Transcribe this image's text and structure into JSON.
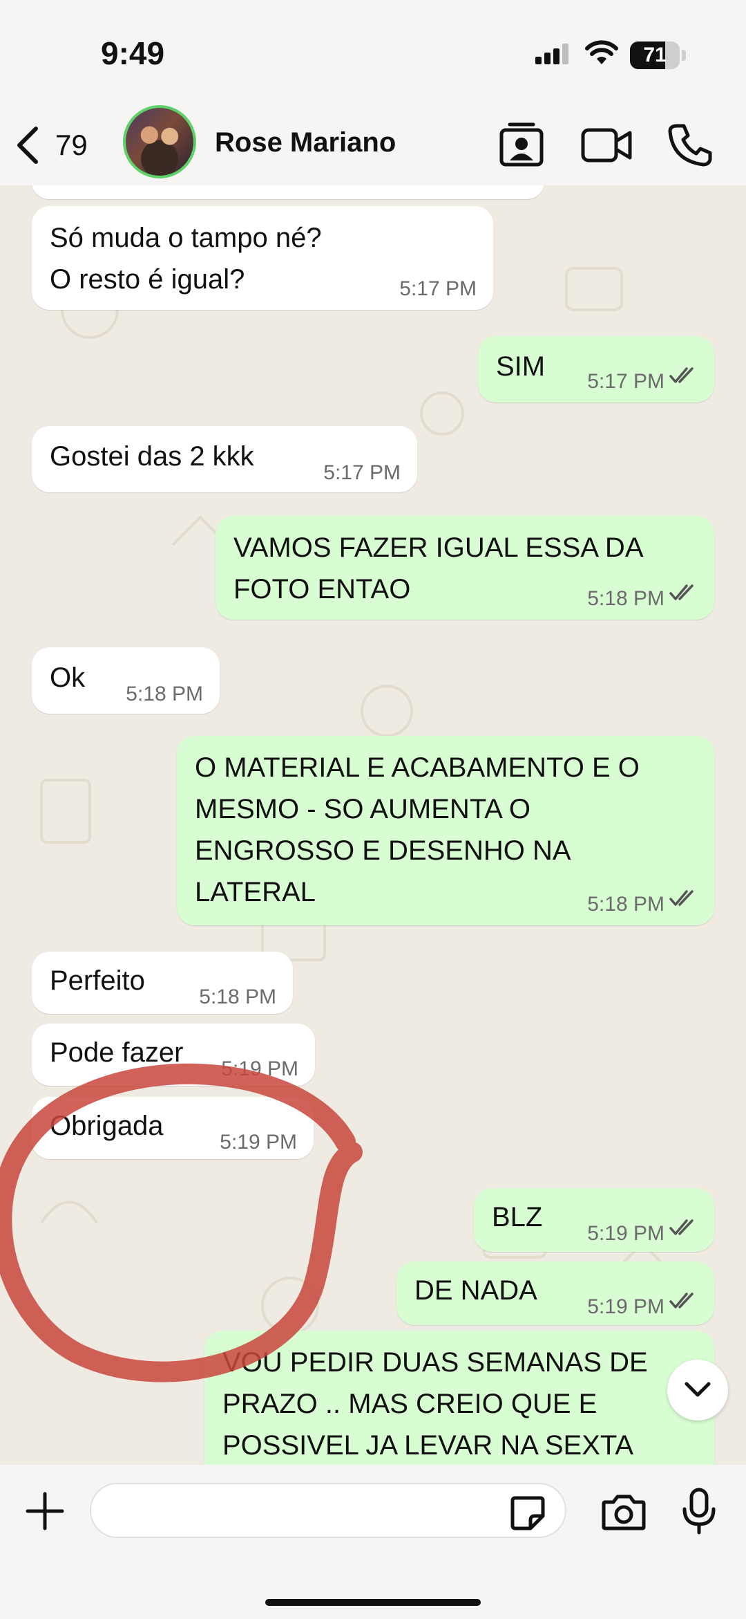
{
  "status_bar": {
    "time": "9:49",
    "battery_percent": "71",
    "battery_level": 0.71
  },
  "header": {
    "back_count": "79",
    "contact_name": "Rose Mariano"
  },
  "messages": [
    {
      "dir": "in",
      "text": "Só muda o tampo né?\nO resto é igual?",
      "time": "5:17 PM"
    },
    {
      "dir": "out",
      "text": "SIM",
      "time": "5:17 PM",
      "read": true
    },
    {
      "dir": "in",
      "text": "Gostei das 2 kkk",
      "time": "5:17 PM"
    },
    {
      "dir": "out",
      "text": "VAMOS FAZER IGUAL ESSA DA\nFOTO ENTAO",
      "time": "5:18 PM",
      "read": true
    },
    {
      "dir": "in",
      "text": "Ok",
      "time": "5:18 PM"
    },
    {
      "dir": "out",
      "text": "O MATERIAL E ACABAMENTO E O\nMESMO -   SO AUMENTA O\nENGROSSO E DESENHO NA\nLATERAL",
      "time": "5:18 PM",
      "read": true
    },
    {
      "dir": "in",
      "text": "Perfeito",
      "time": "5:18 PM"
    },
    {
      "dir": "in",
      "text": "Pode fazer",
      "time": "5:19 PM"
    },
    {
      "dir": "in",
      "text": "Obrigada",
      "time": "5:19 PM"
    },
    {
      "dir": "out",
      "text": "BLZ",
      "time": "5:19 PM",
      "read": true
    },
    {
      "dir": "out",
      "text": "DE NADA",
      "time": "5:19 PM",
      "read": true
    },
    {
      "dir": "out",
      "text": "VOU PEDIR DUAS SEMANAS DE\nPRAZO ..  MAS CREIO QUE E\nPOSSIVEL JA LEVAR NA SEXTA",
      "time": "",
      "read": true
    }
  ],
  "composer": {
    "placeholder": ""
  },
  "colors": {
    "incoming": "#ffffff",
    "outgoing": "#d9fdd3",
    "background": "#efeae2",
    "annotation": "#c8463c",
    "online_ring": "#5fd16a"
  }
}
